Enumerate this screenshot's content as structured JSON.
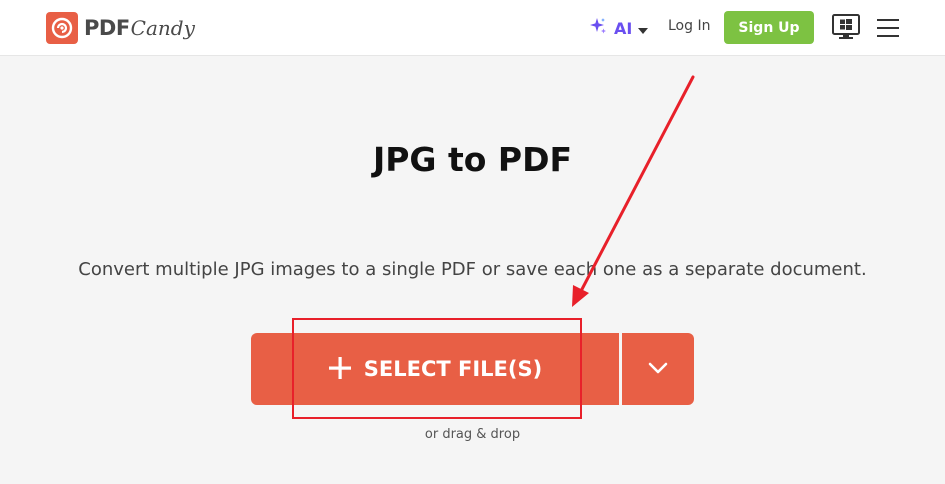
{
  "header": {
    "logo_pdf": "PDF",
    "logo_candy": "Candy",
    "ai_label": "AI",
    "login_label": "Log In",
    "signup_label": "Sign Up"
  },
  "main": {
    "title": "JPG to PDF",
    "subtitle": "Convert multiple JPG images to a single PDF or save each one as a separate document.",
    "select_label": "SELECT FILE(S)",
    "drag_drop": "or drag & drop"
  },
  "icons": {
    "logo": "candy-swirl-icon",
    "ai": "sparkle-icon",
    "ai_caret": "caret-down-icon",
    "desktop": "windows-desktop-icon",
    "menu": "hamburger-menu-icon",
    "plus": "plus-icon",
    "dropdown": "chevron-down-icon"
  },
  "colors": {
    "brand": "#e85f45",
    "signup": "#7dc242",
    "ai": "#6a4ff0",
    "annotation": "#e8202a"
  }
}
